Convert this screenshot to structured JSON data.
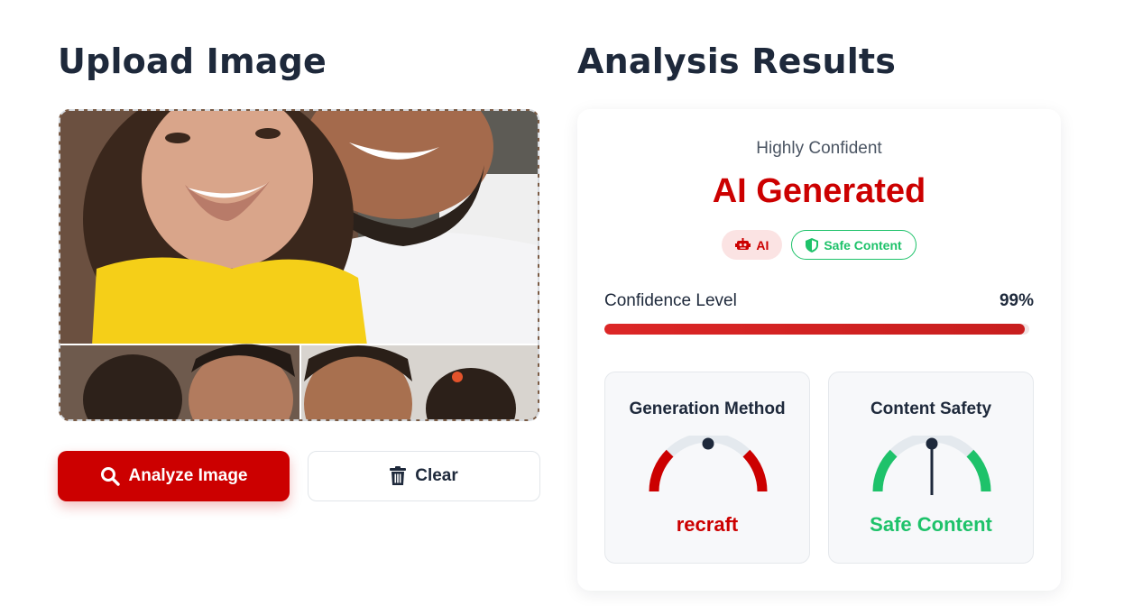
{
  "upload": {
    "title": "Upload Image",
    "analyze_label": "Analyze Image",
    "clear_label": "Clear"
  },
  "results": {
    "title": "Analysis Results",
    "confidence_text": "Highly Confident",
    "verdict": "AI Generated",
    "badges": {
      "ai_label": "AI",
      "safe_label": "Safe Content"
    },
    "confidence": {
      "label": "Confidence Level",
      "value_text": "99%",
      "value": 0.99
    },
    "generation_method": {
      "title": "Generation Method",
      "value": "recraft"
    },
    "content_safety": {
      "title": "Content Safety",
      "value": "Safe Content"
    }
  },
  "colors": {
    "accent": "#cc0000",
    "safe": "#1ec26a",
    "text_dark": "#1e293b"
  },
  "icons": {
    "analyze": "search-icon",
    "clear": "trash-icon",
    "ai_badge": "robot-icon",
    "safe_badge": "shield-icon"
  }
}
